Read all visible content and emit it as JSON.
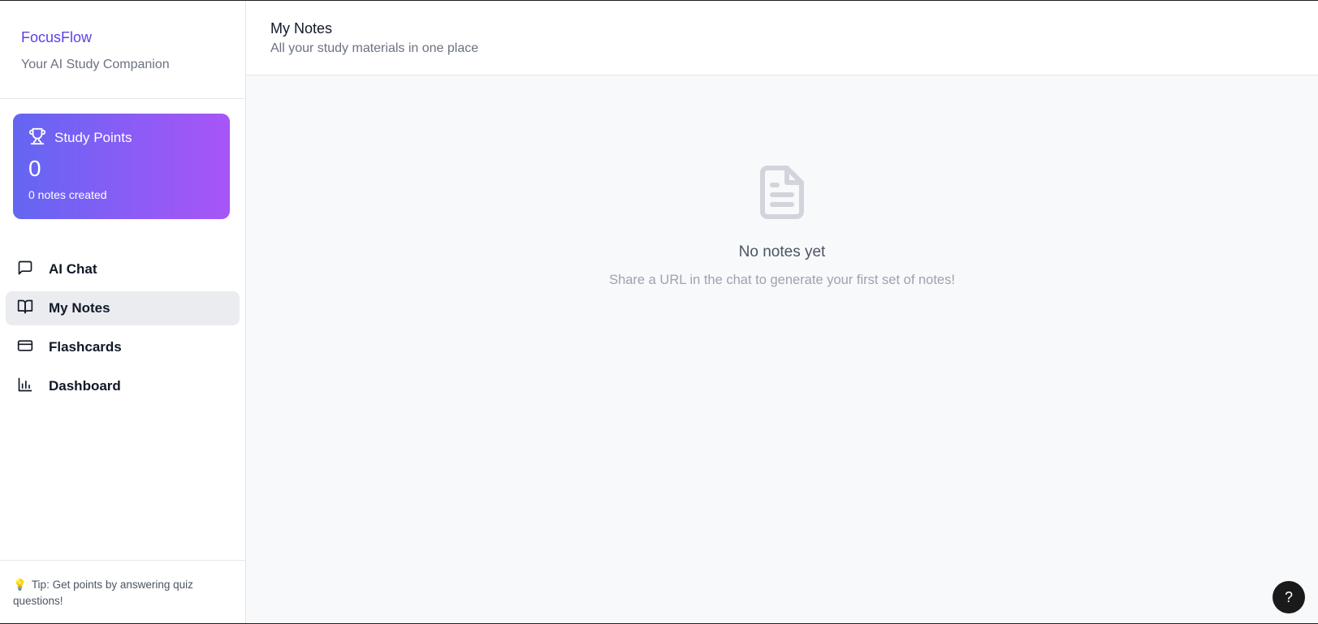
{
  "brand": {
    "name": "FocusFlow",
    "tagline": "Your AI Study Companion",
    "accent_color": "#5b43e6"
  },
  "points_card": {
    "icon": "trophy-icon",
    "title": "Study Points",
    "value": "0",
    "subtitle": "0 notes created",
    "gradient": [
      "#6366f1",
      "#a855f7"
    ]
  },
  "nav": {
    "items": [
      {
        "label": "AI Chat",
        "icon": "message-square-icon",
        "active": false
      },
      {
        "label": "My Notes",
        "icon": "book-open-icon",
        "active": true
      },
      {
        "label": "Flashcards",
        "icon": "credit-card-icon",
        "active": false
      },
      {
        "label": "Dashboard",
        "icon": "bar-chart-icon",
        "active": false
      }
    ]
  },
  "tip": {
    "icon": "lightbulb-icon",
    "text": "Tip: Get points by answering quiz questions!"
  },
  "header": {
    "title": "My Notes",
    "subtitle": "All your study materials in one place"
  },
  "empty_state": {
    "icon": "file-text-icon",
    "title": "No notes yet",
    "message": "Share a URL in the chat to generate your first set of notes!"
  },
  "help_button": {
    "label": "?",
    "icon": "help-icon"
  }
}
